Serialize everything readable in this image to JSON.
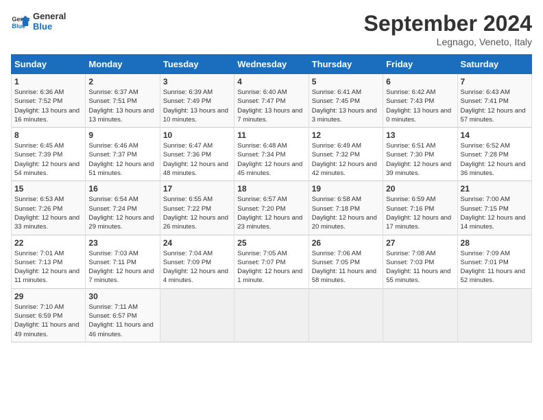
{
  "header": {
    "logo_line1": "General",
    "logo_line2": "Blue",
    "month": "September 2024",
    "location": "Legnago, Veneto, Italy"
  },
  "days_of_week": [
    "Sunday",
    "Monday",
    "Tuesday",
    "Wednesday",
    "Thursday",
    "Friday",
    "Saturday"
  ],
  "weeks": [
    [
      {
        "day": "1",
        "sunrise": "Sunrise: 6:36 AM",
        "sunset": "Sunset: 7:52 PM",
        "daylight": "Daylight: 13 hours and 16 minutes."
      },
      {
        "day": "2",
        "sunrise": "Sunrise: 6:37 AM",
        "sunset": "Sunset: 7:51 PM",
        "daylight": "Daylight: 13 hours and 13 minutes."
      },
      {
        "day": "3",
        "sunrise": "Sunrise: 6:39 AM",
        "sunset": "Sunset: 7:49 PM",
        "daylight": "Daylight: 13 hours and 10 minutes."
      },
      {
        "day": "4",
        "sunrise": "Sunrise: 6:40 AM",
        "sunset": "Sunset: 7:47 PM",
        "daylight": "Daylight: 13 hours and 7 minutes."
      },
      {
        "day": "5",
        "sunrise": "Sunrise: 6:41 AM",
        "sunset": "Sunset: 7:45 PM",
        "daylight": "Daylight: 13 hours and 3 minutes."
      },
      {
        "day": "6",
        "sunrise": "Sunrise: 6:42 AM",
        "sunset": "Sunset: 7:43 PM",
        "daylight": "Daylight: 13 hours and 0 minutes."
      },
      {
        "day": "7",
        "sunrise": "Sunrise: 6:43 AM",
        "sunset": "Sunset: 7:41 PM",
        "daylight": "Daylight: 12 hours and 57 minutes."
      }
    ],
    [
      {
        "day": "8",
        "sunrise": "Sunrise: 6:45 AM",
        "sunset": "Sunset: 7:39 PM",
        "daylight": "Daylight: 12 hours and 54 minutes."
      },
      {
        "day": "9",
        "sunrise": "Sunrise: 6:46 AM",
        "sunset": "Sunset: 7:37 PM",
        "daylight": "Daylight: 12 hours and 51 minutes."
      },
      {
        "day": "10",
        "sunrise": "Sunrise: 6:47 AM",
        "sunset": "Sunset: 7:36 PM",
        "daylight": "Daylight: 12 hours and 48 minutes."
      },
      {
        "day": "11",
        "sunrise": "Sunrise: 6:48 AM",
        "sunset": "Sunset: 7:34 PM",
        "daylight": "Daylight: 12 hours and 45 minutes."
      },
      {
        "day": "12",
        "sunrise": "Sunrise: 6:49 AM",
        "sunset": "Sunset: 7:32 PM",
        "daylight": "Daylight: 12 hours and 42 minutes."
      },
      {
        "day": "13",
        "sunrise": "Sunrise: 6:51 AM",
        "sunset": "Sunset: 7:30 PM",
        "daylight": "Daylight: 12 hours and 39 minutes."
      },
      {
        "day": "14",
        "sunrise": "Sunrise: 6:52 AM",
        "sunset": "Sunset: 7:28 PM",
        "daylight": "Daylight: 12 hours and 36 minutes."
      }
    ],
    [
      {
        "day": "15",
        "sunrise": "Sunrise: 6:53 AM",
        "sunset": "Sunset: 7:26 PM",
        "daylight": "Daylight: 12 hours and 33 minutes."
      },
      {
        "day": "16",
        "sunrise": "Sunrise: 6:54 AM",
        "sunset": "Sunset: 7:24 PM",
        "daylight": "Daylight: 12 hours and 29 minutes."
      },
      {
        "day": "17",
        "sunrise": "Sunrise: 6:55 AM",
        "sunset": "Sunset: 7:22 PM",
        "daylight": "Daylight: 12 hours and 26 minutes."
      },
      {
        "day": "18",
        "sunrise": "Sunrise: 6:57 AM",
        "sunset": "Sunset: 7:20 PM",
        "daylight": "Daylight: 12 hours and 23 minutes."
      },
      {
        "day": "19",
        "sunrise": "Sunrise: 6:58 AM",
        "sunset": "Sunset: 7:18 PM",
        "daylight": "Daylight: 12 hours and 20 minutes."
      },
      {
        "day": "20",
        "sunrise": "Sunrise: 6:59 AM",
        "sunset": "Sunset: 7:16 PM",
        "daylight": "Daylight: 12 hours and 17 minutes."
      },
      {
        "day": "21",
        "sunrise": "Sunrise: 7:00 AM",
        "sunset": "Sunset: 7:15 PM",
        "daylight": "Daylight: 12 hours and 14 minutes."
      }
    ],
    [
      {
        "day": "22",
        "sunrise": "Sunrise: 7:01 AM",
        "sunset": "Sunset: 7:13 PM",
        "daylight": "Daylight: 12 hours and 11 minutes."
      },
      {
        "day": "23",
        "sunrise": "Sunrise: 7:03 AM",
        "sunset": "Sunset: 7:11 PM",
        "daylight": "Daylight: 12 hours and 7 minutes."
      },
      {
        "day": "24",
        "sunrise": "Sunrise: 7:04 AM",
        "sunset": "Sunset: 7:09 PM",
        "daylight": "Daylight: 12 hours and 4 minutes."
      },
      {
        "day": "25",
        "sunrise": "Sunrise: 7:05 AM",
        "sunset": "Sunset: 7:07 PM",
        "daylight": "Daylight: 12 hours and 1 minute."
      },
      {
        "day": "26",
        "sunrise": "Sunrise: 7:06 AM",
        "sunset": "Sunset: 7:05 PM",
        "daylight": "Daylight: 11 hours and 58 minutes."
      },
      {
        "day": "27",
        "sunrise": "Sunrise: 7:08 AM",
        "sunset": "Sunset: 7:03 PM",
        "daylight": "Daylight: 11 hours and 55 minutes."
      },
      {
        "day": "28",
        "sunrise": "Sunrise: 7:09 AM",
        "sunset": "Sunset: 7:01 PM",
        "daylight": "Daylight: 11 hours and 52 minutes."
      }
    ],
    [
      {
        "day": "29",
        "sunrise": "Sunrise: 7:10 AM",
        "sunset": "Sunset: 6:59 PM",
        "daylight": "Daylight: 11 hours and 49 minutes."
      },
      {
        "day": "30",
        "sunrise": "Sunrise: 7:11 AM",
        "sunset": "Sunset: 6:57 PM",
        "daylight": "Daylight: 11 hours and 46 minutes."
      },
      {
        "day": "",
        "sunrise": "",
        "sunset": "",
        "daylight": ""
      },
      {
        "day": "",
        "sunrise": "",
        "sunset": "",
        "daylight": ""
      },
      {
        "day": "",
        "sunrise": "",
        "sunset": "",
        "daylight": ""
      },
      {
        "day": "",
        "sunrise": "",
        "sunset": "",
        "daylight": ""
      },
      {
        "day": "",
        "sunrise": "",
        "sunset": "",
        "daylight": ""
      }
    ]
  ]
}
